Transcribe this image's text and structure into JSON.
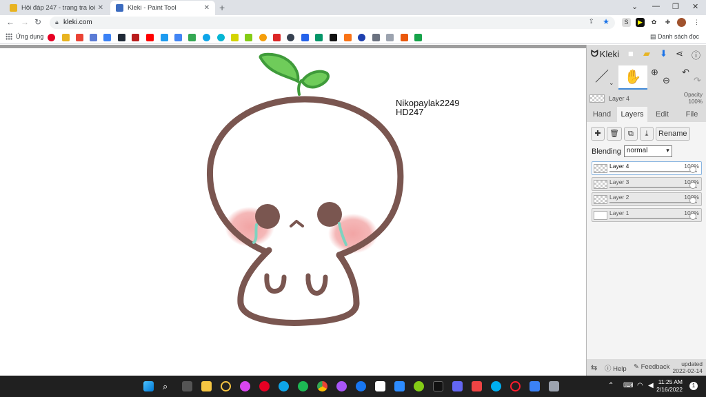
{
  "browser": {
    "tabs": [
      {
        "title": "Hỏi đáp 247 - trang tra loi",
        "active": false,
        "favicon_color": "#e8b320"
      },
      {
        "title": "Kleki - Paint Tool",
        "active": true,
        "favicon_color": "#3b6bbf"
      }
    ],
    "url": "kleki.com",
    "apps_label": "Ứng dụng",
    "reading_list_label": "Danh sách đọc"
  },
  "canvas": {
    "signature_line1": "Nikopaylak2249",
    "signature_line2": "HD247",
    "colors": {
      "outline": "#7a5650",
      "leaf": "#6fcc5a",
      "leaf_stroke": "#3f9b3a",
      "blush": "#f1a0a0",
      "tear": "#7ed3c0"
    }
  },
  "kleki": {
    "logo": "Kleki",
    "current_layer": "Layer 4",
    "opacity_label": "Opacity",
    "opacity_value": "100%",
    "tabs": [
      "Hand",
      "Layers",
      "Edit",
      "File"
    ],
    "active_tab": "Layers",
    "rename_label": "Rename",
    "blending_label": "Blending",
    "blending_value": "normal",
    "layers": [
      {
        "name": "Layer 4",
        "opacity": "100%",
        "selected": true
      },
      {
        "name": "Layer 3",
        "opacity": "100%",
        "selected": false
      },
      {
        "name": "Layer 2",
        "opacity": "100%",
        "selected": false
      },
      {
        "name": "Layer 1",
        "opacity": "100%",
        "selected": false
      }
    ],
    "help_label": "Help",
    "feedback_label": "Feedback",
    "updated_label": "updated",
    "updated_date": "2022-02-14",
    "accent": "#3f88d6"
  },
  "taskbar": {
    "time": "11:25 AM",
    "date": "2/16/2022",
    "notification_count": "1"
  }
}
